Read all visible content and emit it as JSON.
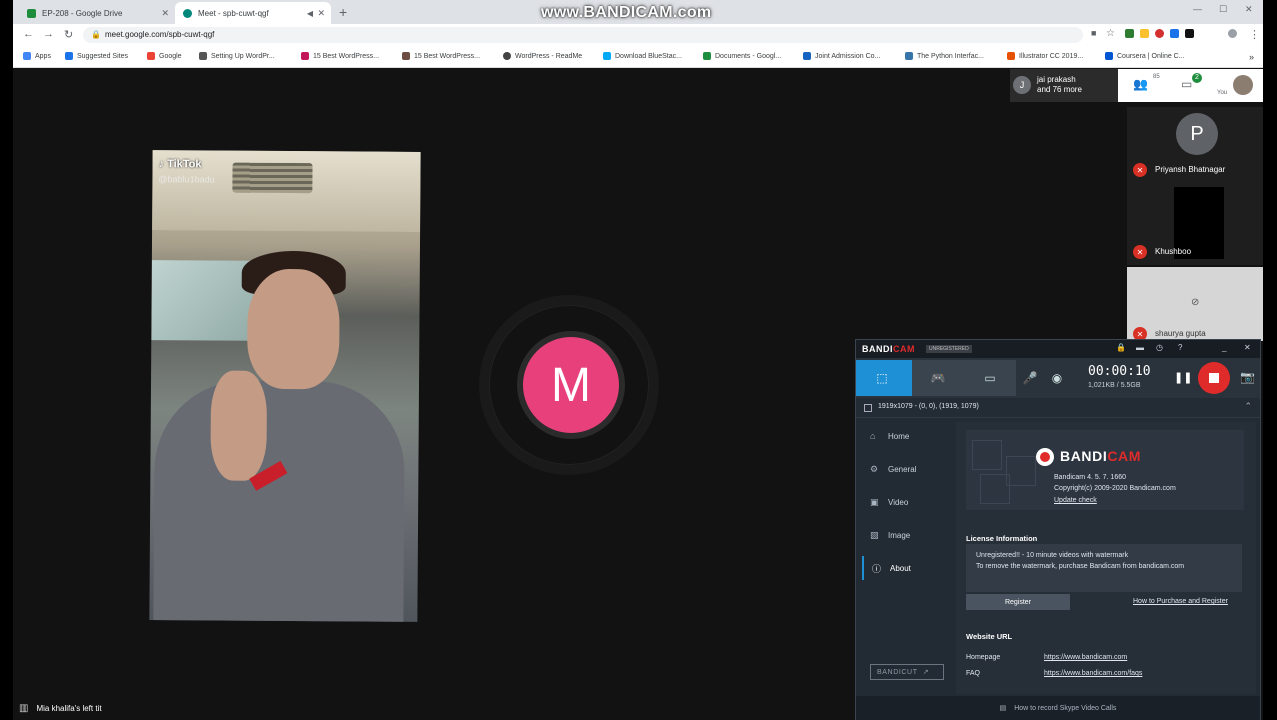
{
  "browser": {
    "tabs": [
      {
        "label": "EP-208 - Google Drive",
        "favicon_color": "#1e8e3e"
      },
      {
        "label": "Meet - spb-cuwt-qgf",
        "favicon_color": "#00897b"
      }
    ],
    "watermark": "www.BANDICAM.com",
    "url": "meet.google.com/spb-cuwt-qgf",
    "bookmarks": [
      {
        "label": "Apps",
        "color": "#4285f4"
      },
      {
        "label": "Suggested Sites",
        "color": "#1a73e8"
      },
      {
        "label": "Google",
        "color": "#ea4335"
      },
      {
        "label": "Setting Up WordPr...",
        "color": "#555"
      },
      {
        "label": "15 Best WordPress...",
        "color": "#c2185b"
      },
      {
        "label": "15 Best WordPress...",
        "color": "#6d4c41"
      },
      {
        "label": "WordPress - ReadMe",
        "color": "#444"
      },
      {
        "label": "Download BlueStac...",
        "color": "#03a9f4"
      },
      {
        "label": "Documents - Googl...",
        "color": "#1e8e3e"
      },
      {
        "label": "Joint Admission Co...",
        "color": "#1565c0"
      },
      {
        "label": "The Python Interfac...",
        "color": "#3776ab"
      },
      {
        "label": "Illustrator CC 2019...",
        "color": "#e65100"
      },
      {
        "label": "Coursera | Online C...",
        "color": "#0056d2"
      }
    ]
  },
  "meet": {
    "presenter": {
      "name": "jai prakash",
      "more": "and 76 more",
      "initial": "J"
    },
    "people_count": "85",
    "chat_badge": "2",
    "you_label": "You",
    "main_avatar_initial": "M",
    "video_overlay": {
      "brand": "TikTok",
      "handle": "@bablu1badu"
    },
    "participants": [
      {
        "name": "Priyansh Bhatnagar",
        "initial": "P"
      },
      {
        "name": "Khushboo"
      },
      {
        "name": "shaurya gupta"
      }
    ],
    "left_notice": "Mia khalifa's left tit"
  },
  "bandicam": {
    "logo_a": "BANDI",
    "logo_b": "CAM",
    "unregistered": "UNREGISTERED",
    "timer": "00:00:10",
    "size": "1,021KB / 5.5GB",
    "area": "1919x1079 - (0, 0), (1919, 1079)",
    "nav": [
      "Home",
      "General",
      "Video",
      "Image",
      "About"
    ],
    "nav_selected": "About",
    "version": "Bandicam 4. 5. 7. 1660",
    "copyright": "Copyright(c) 2009-2020 Bandicam.com",
    "update": "Update check",
    "license_heading": "License Information",
    "license_line1": "Unregistered!! - 10 minute videos with watermark",
    "license_line2": "To remove the watermark, purchase Bandicam from bandicam.com",
    "register": "Register",
    "howto": "How to Purchase and Register",
    "website_heading": "Website URL",
    "homepage_label": "Homepage",
    "homepage_url": "https://www.bandicam.com",
    "faq_label": "FAQ",
    "faq_url": "https://www.bandicam.com/faqs",
    "bandicut": "BANDICUT",
    "footer": "How to record Skype Video Calls",
    "accent": "#1e90d6",
    "rec_color": "#e02b2b"
  }
}
